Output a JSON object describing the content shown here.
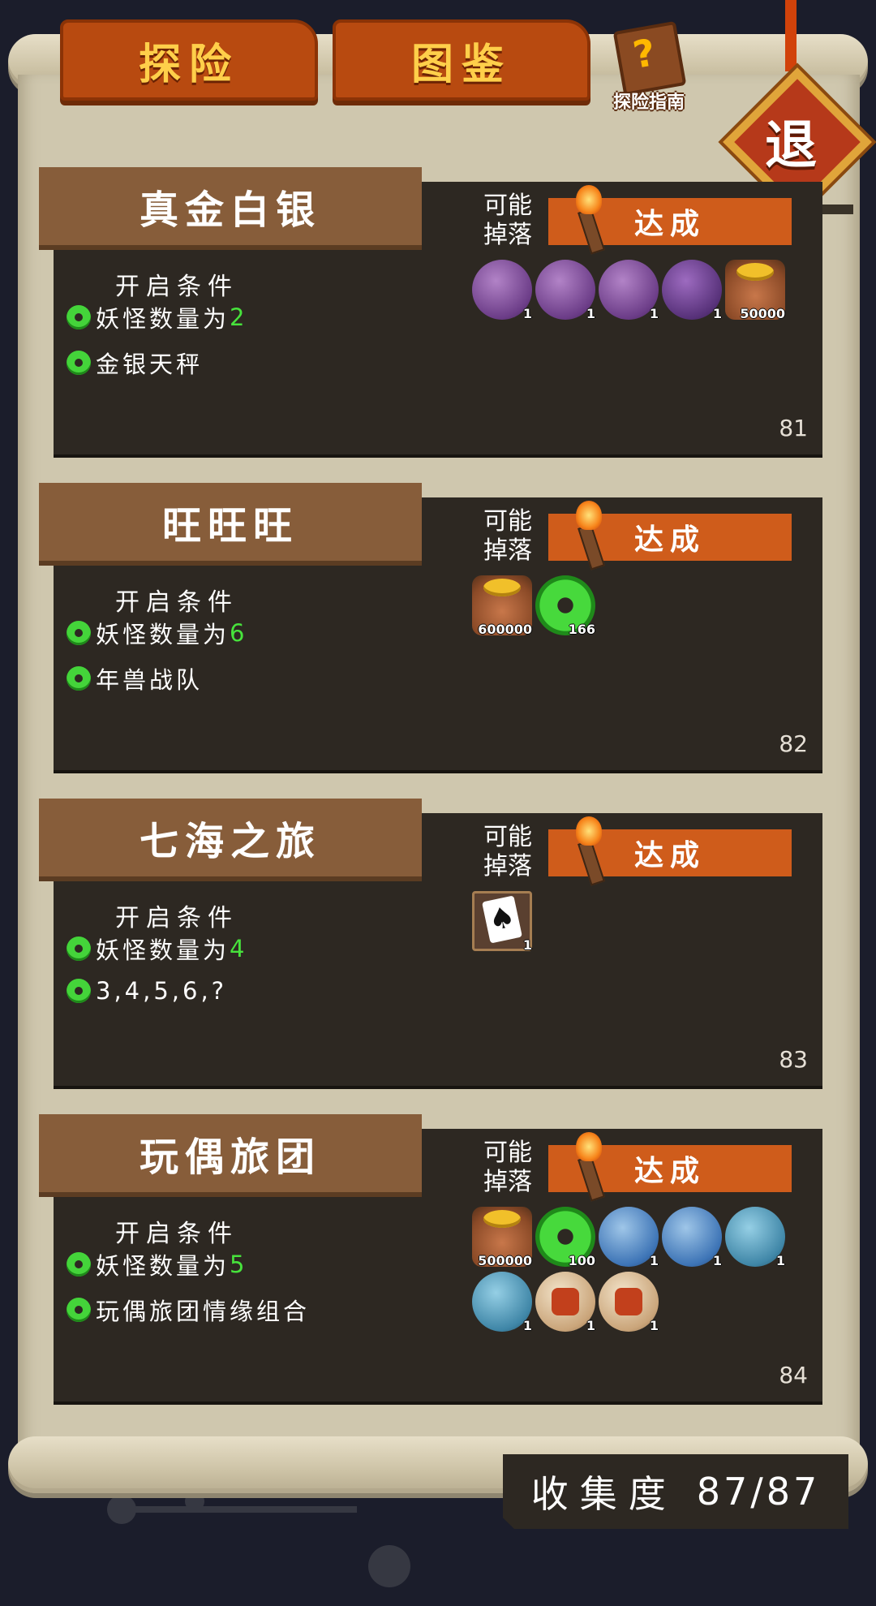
{
  "tabs": {
    "explore": "探险",
    "codex": "图鉴"
  },
  "guide": {
    "label": "探险指南",
    "icon": "question-book-icon"
  },
  "exit": {
    "label": "退"
  },
  "cards": [
    {
      "title": "真金白银",
      "cond_header": "开启条件",
      "cond1_prefix": "妖怪数量为",
      "cond1_value": "2",
      "cond2": "金银天秤",
      "drop_label": "可能掉落",
      "status": "达成",
      "number": "81",
      "items": [
        {
          "icon": "peacock-feather-icon",
          "count": "1"
        },
        {
          "icon": "peacock-feather-icon",
          "count": "1"
        },
        {
          "icon": "peacock-feather-icon",
          "count": "1"
        },
        {
          "icon": "peacock-fan-icon",
          "count": "1"
        },
        {
          "icon": "gold-bag-icon",
          "count": "50000"
        }
      ]
    },
    {
      "title": "旺旺旺",
      "cond_header": "开启条件",
      "cond1_prefix": "妖怪数量为",
      "cond1_value": "6",
      "cond2": "年兽战队",
      "drop_label": "可能掉落",
      "status": "达成",
      "number": "82",
      "items": [
        {
          "icon": "gold-bag-icon",
          "count": "600000"
        },
        {
          "icon": "jade-coin-icon",
          "count": "166"
        }
      ]
    },
    {
      "title": "七海之旅",
      "cond_header": "开启条件",
      "cond1_prefix": "妖怪数量为",
      "cond1_value": "4",
      "cond2": "3,4,5,6,?",
      "drop_label": "可能掉落",
      "status": "达成",
      "number": "83",
      "items": [
        {
          "icon": "spade-card-icon",
          "count": "1"
        }
      ]
    },
    {
      "title": "玩偶旅团",
      "cond_header": "开启条件",
      "cond1_prefix": "妖怪数量为",
      "cond1_value": "5",
      "cond2": "玩偶旅团情缘组合",
      "drop_label": "可能掉落",
      "status": "达成",
      "number": "84",
      "items": [
        {
          "icon": "gold-bag-icon",
          "count": "500000"
        },
        {
          "icon": "jade-coin-icon",
          "count": "100"
        },
        {
          "icon": "blue-robot-icon",
          "count": "1"
        },
        {
          "icon": "ice-cube-icon",
          "count": "1"
        },
        {
          "icon": "blue-mask-icon",
          "count": "1"
        },
        {
          "icon": "teal-emblem-icon",
          "count": "1"
        },
        {
          "icon": "red-demon-icon",
          "count": "1"
        },
        {
          "icon": "red-beast-icon",
          "count": "1"
        }
      ]
    }
  ],
  "collection": {
    "label": "收集度",
    "value": "87/87"
  }
}
